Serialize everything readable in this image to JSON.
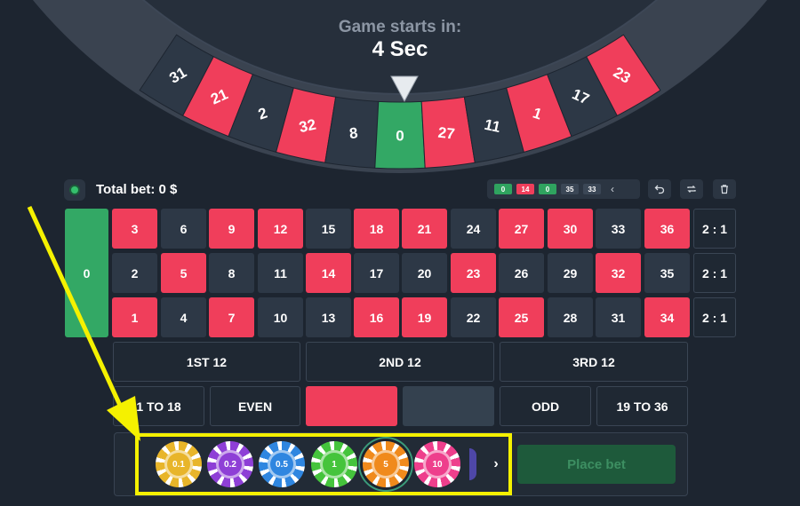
{
  "countdown": {
    "label": "Game starts in:",
    "value": "4 Sec"
  },
  "wheel": {
    "pockets": [
      {
        "n": "31",
        "color": "black"
      },
      {
        "n": "21",
        "color": "red"
      },
      {
        "n": "2",
        "color": "black"
      },
      {
        "n": "32",
        "color": "red"
      },
      {
        "n": "8",
        "color": "black"
      },
      {
        "n": "0",
        "color": "green"
      },
      {
        "n": "27",
        "color": "red"
      },
      {
        "n": "11",
        "color": "black"
      },
      {
        "n": "1",
        "color": "red"
      },
      {
        "n": "17",
        "color": "black"
      },
      {
        "n": "23",
        "color": "red"
      }
    ]
  },
  "total_bet": "Total bet: 0 $",
  "history": [
    {
      "n": "0",
      "color": "green"
    },
    {
      "n": "14",
      "color": "red"
    },
    {
      "n": "0",
      "color": "green"
    },
    {
      "n": "35",
      "color": "dark"
    },
    {
      "n": "33",
      "color": "dark"
    }
  ],
  "history_arrow": "‹",
  "tools": {
    "undo_icon": "undo-icon",
    "repeat_icon": "repeat-icon",
    "clear_icon": "trash-icon"
  },
  "board": {
    "zero": "0",
    "rows": [
      [
        {
          "n": "3",
          "c": "red"
        },
        {
          "n": "6",
          "c": "black"
        },
        {
          "n": "9",
          "c": "red"
        },
        {
          "n": "12",
          "c": "red"
        },
        {
          "n": "15",
          "c": "black"
        },
        {
          "n": "18",
          "c": "red"
        },
        {
          "n": "21",
          "c": "red"
        },
        {
          "n": "24",
          "c": "black"
        },
        {
          "n": "27",
          "c": "red"
        },
        {
          "n": "30",
          "c": "red"
        },
        {
          "n": "33",
          "c": "black"
        },
        {
          "n": "36",
          "c": "red"
        }
      ],
      [
        {
          "n": "2",
          "c": "black"
        },
        {
          "n": "5",
          "c": "red"
        },
        {
          "n": "8",
          "c": "black"
        },
        {
          "n": "11",
          "c": "black"
        },
        {
          "n": "14",
          "c": "red"
        },
        {
          "n": "17",
          "c": "black"
        },
        {
          "n": "20",
          "c": "black"
        },
        {
          "n": "23",
          "c": "red"
        },
        {
          "n": "26",
          "c": "black"
        },
        {
          "n": "29",
          "c": "black"
        },
        {
          "n": "32",
          "c": "red"
        },
        {
          "n": "35",
          "c": "black"
        }
      ],
      [
        {
          "n": "1",
          "c": "red"
        },
        {
          "n": "4",
          "c": "black"
        },
        {
          "n": "7",
          "c": "red"
        },
        {
          "n": "10",
          "c": "black"
        },
        {
          "n": "13",
          "c": "black"
        },
        {
          "n": "16",
          "c": "red"
        },
        {
          "n": "19",
          "c": "red"
        },
        {
          "n": "22",
          "c": "black"
        },
        {
          "n": "25",
          "c": "red"
        },
        {
          "n": "28",
          "c": "black"
        },
        {
          "n": "31",
          "c": "black"
        },
        {
          "n": "34",
          "c": "red"
        }
      ]
    ],
    "column_bets": [
      "2 : 1",
      "2 : 1",
      "2 : 1"
    ],
    "dozens": [
      "1ST 12",
      "2ND 12",
      "3RD 12"
    ],
    "even_money": [
      "1 TO 18",
      "EVEN",
      "",
      "",
      "ODD",
      "19 TO 36"
    ]
  },
  "chips": [
    {
      "value": "0.1",
      "color": "#e8b52a"
    },
    {
      "value": "0.2",
      "color": "#8e3fd6"
    },
    {
      "value": "0.5",
      "color": "#2f86e0"
    },
    {
      "value": "1",
      "color": "#45c43c"
    },
    {
      "value": "5",
      "color": "#f08a1c",
      "selected": true
    },
    {
      "value": "10",
      "color": "#ee3f8c"
    }
  ],
  "chip_next": "›",
  "place_bet_label": "Place bet",
  "colors": {
    "red": "#f03e5b",
    "black": "#2d3846",
    "green": "#33a865",
    "highlight": "#f5f100"
  }
}
